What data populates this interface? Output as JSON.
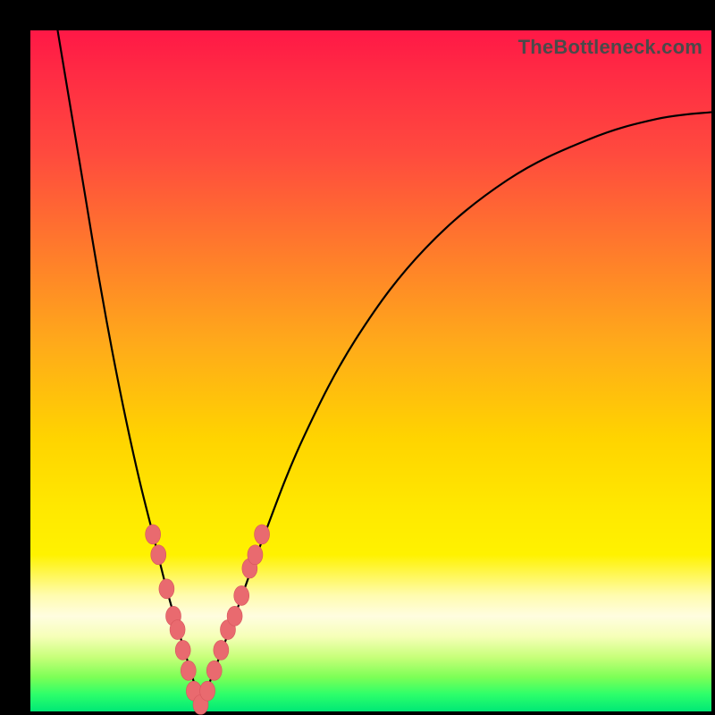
{
  "watermark": "TheBottleneck.com",
  "chart_data": {
    "type": "line",
    "title": "",
    "xlabel": "",
    "ylabel": "",
    "xlim": [
      0,
      100
    ],
    "ylim": [
      0,
      100
    ],
    "grid": false,
    "legend": null,
    "background_gradient": {
      "direction": "vertical",
      "stops": [
        {
          "pos": 0,
          "color": "#ff1846"
        },
        {
          "pos": 32,
          "color": "#ff7a2c"
        },
        {
          "pos": 60,
          "color": "#ffd400"
        },
        {
          "pos": 86,
          "color": "#fffde0"
        },
        {
          "pos": 100,
          "color": "#00e876"
        }
      ]
    },
    "series": [
      {
        "name": "left-branch",
        "x": [
          4,
          6,
          8,
          10,
          12,
          14,
          16,
          18,
          20,
          22,
          23.5,
          25
        ],
        "values": [
          100,
          88,
          76,
          64,
          53,
          43,
          34,
          26,
          18,
          11,
          6,
          1
        ]
      },
      {
        "name": "right-branch",
        "x": [
          25,
          27,
          30,
          34,
          40,
          48,
          58,
          70,
          82,
          92,
          100
        ],
        "values": [
          1,
          6,
          14,
          25,
          40,
          55,
          68,
          78,
          84,
          87,
          88
        ]
      }
    ],
    "markers": {
      "name": "highlighted-range",
      "color": "#e96a6f",
      "points": [
        {
          "x": 18.0,
          "y": 26
        },
        {
          "x": 18.8,
          "y": 23
        },
        {
          "x": 20.0,
          "y": 18
        },
        {
          "x": 21.0,
          "y": 14
        },
        {
          "x": 21.6,
          "y": 12
        },
        {
          "x": 22.4,
          "y": 9
        },
        {
          "x": 23.2,
          "y": 6
        },
        {
          "x": 24.0,
          "y": 3
        },
        {
          "x": 25.0,
          "y": 1
        },
        {
          "x": 26.0,
          "y": 3
        },
        {
          "x": 27.0,
          "y": 6
        },
        {
          "x": 28.0,
          "y": 9
        },
        {
          "x": 29.0,
          "y": 12
        },
        {
          "x": 30.0,
          "y": 14
        },
        {
          "x": 31.0,
          "y": 17
        },
        {
          "x": 32.2,
          "y": 21
        },
        {
          "x": 33.0,
          "y": 23
        },
        {
          "x": 34.0,
          "y": 26
        }
      ]
    }
  }
}
